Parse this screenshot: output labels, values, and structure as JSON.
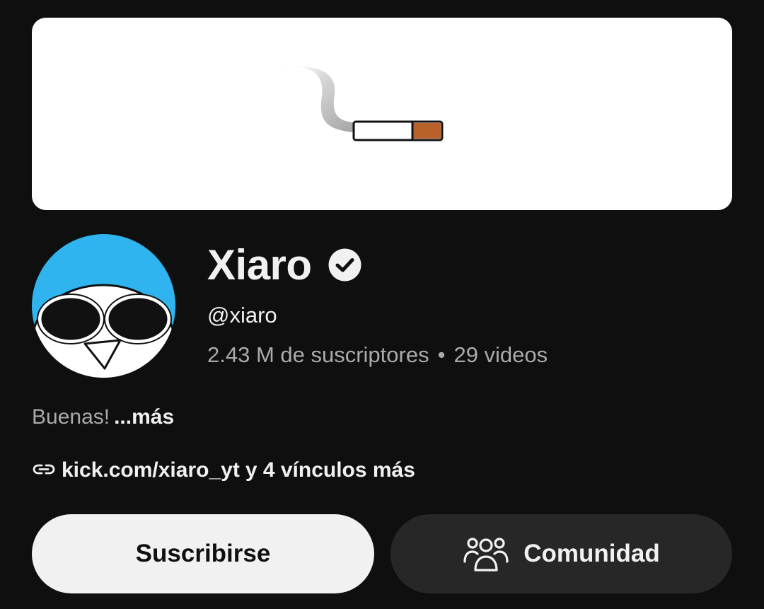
{
  "banner": {
    "background": "#ffffff",
    "illustration": "cigarette-smoke"
  },
  "channel": {
    "avatar_color": "#2fb4ef",
    "name": "Xiaro",
    "verified": true,
    "handle": "@xiaro",
    "subscribers": "2.43 M de suscriptores",
    "separator": "•",
    "videos": "29 videos",
    "description": "Buenas!",
    "description_more": "...más",
    "link_url": "kick.com/xiaro_yt",
    "link_more": "y 4 vínculos más"
  },
  "actions": {
    "subscribe_label": "Suscribirse",
    "community_label": "Comunidad"
  },
  "icons": {
    "verified": "check-circle-icon",
    "link": "link-icon",
    "community": "people-group-icon"
  }
}
